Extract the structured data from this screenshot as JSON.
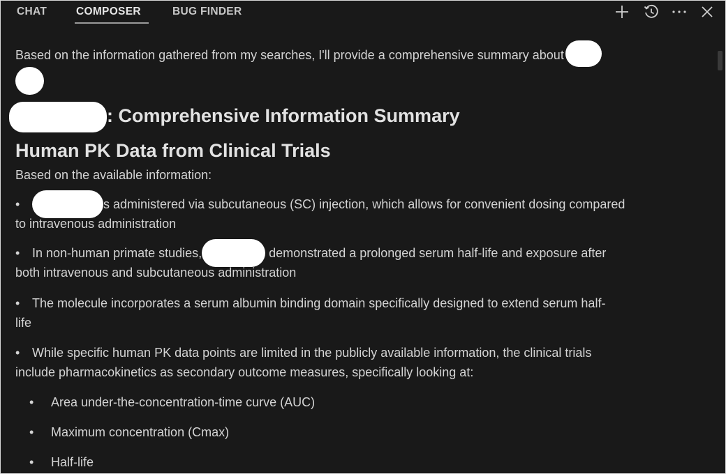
{
  "tabs": [
    {
      "label": "CHAT",
      "active": false
    },
    {
      "label": "COMPOSER",
      "active": true
    },
    {
      "label": "BUG FINDER",
      "active": false
    }
  ],
  "toolbar": {
    "icons": [
      "plus-icon",
      "history-icon",
      "more-icon",
      "close-icon"
    ]
  },
  "message": {
    "intro": "Based on the information gathered from my searches, I'll provide a comprehensive summary about",
    "title_suffix": ": Comprehensive Information Summary",
    "section_heading": "Human PK Data from Clinical Trials",
    "lead": "Based on the available information:",
    "bullets": [
      {
        "dot": "•",
        "part1": "s administered via subcutaneous (SC) injection, which allows for convenient dosing compared",
        "part2": "to intravenous administration"
      },
      {
        "dot": "•",
        "pre": "In non-human primate studies,",
        "post": " demonstrated a prolonged serum half-life and exposure after",
        "part2": "both intravenous and subcutaneous administration"
      },
      {
        "dot": "•",
        "line1": "The molecule incorporates a serum albumin binding domain specifically designed to extend serum half-",
        "line2": "life"
      },
      {
        "dot": "•",
        "line1": "While specific human PK data points are limited in the publicly available information, the clinical trials",
        "line2": "include pharmacokinetics as secondary outcome measures, specifically looking at:"
      }
    ],
    "subbullets": [
      {
        "dot": "•",
        "text": "Area under-the-concentration-time curve (AUC)"
      },
      {
        "dot": "•",
        "text": "Maximum concentration (Cmax)"
      },
      {
        "dot": "•",
        "text": "Half-life"
      }
    ]
  },
  "colors": {
    "background": "#191919",
    "text": "#d4d4d4",
    "redaction": "#ffffff"
  }
}
